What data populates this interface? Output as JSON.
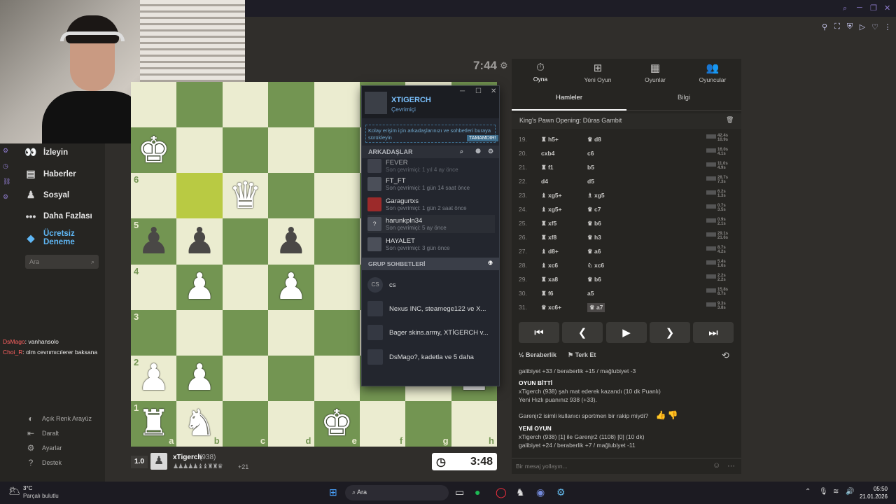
{
  "sidebar": {
    "items": [
      {
        "icon": "binoculars-icon",
        "glyph": "👀",
        "label": "İzleyin"
      },
      {
        "icon": "news-icon",
        "glyph": "▤",
        "label": "Haberler"
      },
      {
        "icon": "social-icon",
        "glyph": "♟",
        "label": "Sosyal"
      },
      {
        "icon": "more-icon",
        "glyph": "•••",
        "label": "Daha Fazlası"
      }
    ],
    "trial": "Ücretsiz Deneme",
    "search_placeholder": "Ara",
    "bottom": [
      {
        "icon": "light-theme-icon",
        "glyph": "◐",
        "label": "Açık Renk Arayüz"
      },
      {
        "icon": "collapse-icon",
        "glyph": "⇤",
        "label": "Daralt"
      },
      {
        "icon": "settings-icon",
        "glyph": "⚙",
        "label": "Ayarlar"
      },
      {
        "icon": "help-icon",
        "glyph": "?",
        "label": "Destek"
      }
    ]
  },
  "stream_chat": [
    {
      "user": "DsMago",
      "text": ": vanhansolo"
    },
    {
      "user": "Choi_R",
      "text": ": olm cevrımıcılerer baksana"
    }
  ],
  "board": {
    "top_clock": "7:44",
    "bottom_clock": "3:48",
    "ranks": [
      "6",
      "5",
      "4",
      "3",
      "2",
      "1"
    ],
    "files": [
      "a",
      "b",
      "c",
      "d",
      "e",
      "f",
      "g",
      "h"
    ],
    "player": {
      "rating_diff": "1.0",
      "name": "xTigerch",
      "rating": "(938)",
      "material": "+21"
    }
  },
  "steam": {
    "username": "XTIGERCH",
    "status": "Çevrimiçi",
    "hint": "Kolay erişim için arkadaşlarınızı ve sohbetleri buraya sürükleyin",
    "hint_button": "TAMAMDIR!",
    "friends_header": "ARKADAŞLAR",
    "friends": [
      {
        "name": "FEVER",
        "status": "Son çevrimiçi: 1 yıl 4 ay önce"
      },
      {
        "name": "FT_FT",
        "status": "Son çevrimiçi: 1 gün 14 saat önce"
      },
      {
        "name": "Garagurtxs",
        "status": "Son çevrimiçi: 1 gün 2 saat önce"
      },
      {
        "name": "harunkpln34",
        "status": "Son çevrimiçi: 5 ay önce"
      },
      {
        "name": "HAYALET",
        "status": "Son çevrimiçi: 3 gün önce"
      }
    ],
    "groups_header": "GRUP SOHBETLERİ",
    "groups": [
      {
        "avatar": "CS",
        "name": "cs"
      },
      {
        "avatar": "",
        "name": "Nexus INC, steamege122 ve X..."
      },
      {
        "avatar": "",
        "name": "Bager skins.army, XTİGERCH v..."
      },
      {
        "avatar": "",
        "name": "DsMago?, kadetla ve 5 daha"
      }
    ]
  },
  "panel": {
    "tabs": [
      {
        "icon": "stopwatch-icon",
        "glyph": "⏱",
        "label": "Oyna"
      },
      {
        "icon": "plus-icon",
        "glyph": "⊞",
        "label": "Yeni Oyun"
      },
      {
        "icon": "board-icon",
        "glyph": "▦",
        "label": "Oyunlar"
      },
      {
        "icon": "players-icon",
        "glyph": "👥",
        "label": "Oyuncular"
      }
    ],
    "subtabs": [
      "Hamleler",
      "Bilgi"
    ],
    "opening": "King's Pawn Opening: Dûras Gambit",
    "moves": [
      {
        "n": "19.",
        "w": "♜ h5+",
        "b": "♛ d8",
        "t": "42.4s 10.9s"
      },
      {
        "n": "20.",
        "w": "cxb4",
        "b": "c6",
        "t": "16.0s 4.1s"
      },
      {
        "n": "21.",
        "w": "♜ f1",
        "b": "b5",
        "t": "11.0s 4.9s"
      },
      {
        "n": "22.",
        "w": "d4",
        "b": "d5",
        "t": "28.7s 7.3s"
      },
      {
        "n": "23.",
        "w": "♝ xg5+",
        "b": "♗ xg5",
        "t": "6.2s 1.3s"
      },
      {
        "n": "24.",
        "w": "♝ xg5+",
        "b": "♛ c7",
        "t": "0.7s 3.5s"
      },
      {
        "n": "25.",
        "w": "♜ xf5",
        "b": "♛ b6",
        "t": "0.9s 2.1s"
      },
      {
        "n": "26.",
        "w": "♜ xf8",
        "b": "♛ h3",
        "t": "29.1s 21.6s"
      },
      {
        "n": "27.",
        "w": "♝ d8+",
        "b": "♛ a6",
        "t": "8.7s 4.2s"
      },
      {
        "n": "28.",
        "w": "♝ xc6",
        "b": "♘ xc6",
        "t": "5.4s 1.6s"
      },
      {
        "n": "29.",
        "w": "♜ xa8",
        "b": "♛ b6",
        "t": "2.2s 2.2s"
      },
      {
        "n": "30.",
        "w": "♜ f6",
        "b": "a5",
        "t": "15.8s 8.7s"
      },
      {
        "n": "31.",
        "w": "♛ xc6+",
        "b": "♛ a7",
        "t": "9.3s 3.8s"
      }
    ],
    "draw_label": "Beraberlik",
    "resign_label": "Terk Et",
    "log": [
      "galibiyet +33 / beraberlik +15 / mağlubiyet -3",
      "OYUN BİTTİ",
      "xTigerch (938) şah mat ederek kazandı (10 dk Puanlı)",
      "Yeni Hızlı puanınız 938 (+33).",
      "Garenjr2 isimli kullanıcı sportmen bir rakip miydi?",
      "YENİ OYUN",
      "xTigerch (938) [1] ile Garenjr2 (1108) [0] (10 dk)",
      "galibiyet +24 / beraberlik +7 / mağlubiyet -11"
    ],
    "message_placeholder": "Bir mesaj yollayın..."
  },
  "taskbar": {
    "weather_temp": "3°C",
    "weather_desc": "Parçalı bulutlu",
    "search": "Ara",
    "time": "05:50",
    "date": "21.01.2026"
  }
}
